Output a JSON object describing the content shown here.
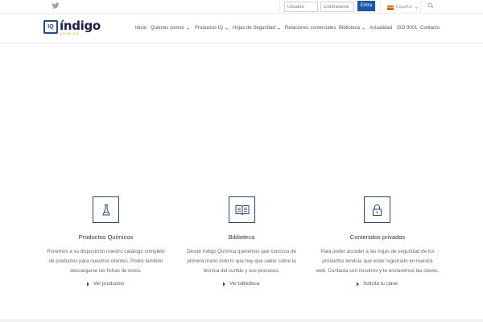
{
  "topbar": {
    "user_placeholder": "Usuario",
    "pass_placeholder": "Contraseña",
    "login_label": "Entra",
    "language": "Español",
    "icons": {
      "social": "twitter-icon",
      "search": "search-icon",
      "flag": "spain-flag-icon"
    }
  },
  "header": {
    "logo_badge": "IQ",
    "logo_word": "índigo",
    "logo_sub": "QUIMICA"
  },
  "nav": {
    "items": [
      {
        "label": "Inicio"
      },
      {
        "label": "Quienes somos"
      },
      {
        "label": "Productos IQ"
      },
      {
        "label": "Hojas de Seguridad"
      },
      {
        "label": "Relaciones comerciales"
      },
      {
        "label": "Biblioteca"
      },
      {
        "label": "Actualidad"
      },
      {
        "label": "ISO 9001"
      },
      {
        "label": "Contacto"
      }
    ],
    "active_color": "#1a56a8"
  },
  "features": [
    {
      "icon": "flask-icon",
      "title": "Productos Químicos",
      "lines": [
        "Ponemos a su disposición nuestro catálogo completo",
        "de productos para nuestros clientes. Podrá también",
        "descargarse las fichas de estos."
      ],
      "link": "Ver productos"
    },
    {
      "icon": "book-icon",
      "title": "Biblioteca",
      "lines": [
        "Desde índigo Química queremos que conozca de",
        "primera mano todo lo que hay que saber sobre la",
        "técnica del curtido y sus procesos."
      ],
      "link": "Ver bilbioteca"
    },
    {
      "icon": "lock-icon",
      "title": "Contenidos privados",
      "lines": [
        "Para poder acceder a las hojas de seguridad de los",
        "productos tendrás que estar registrado en nuestra",
        "web. Contacta con nosotros y te enviaremos las claves."
      ],
      "link": "Solicita tu clave"
    }
  ],
  "colors": {
    "brand": "#1a56a8",
    "logo_text": "#1c1c5a",
    "logo_accent": "#f0b800"
  }
}
